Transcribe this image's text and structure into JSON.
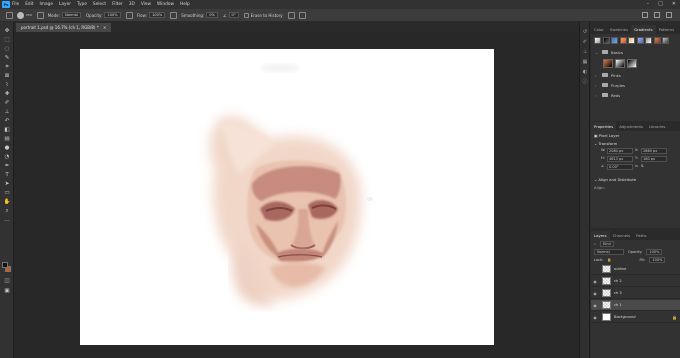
{
  "app": {
    "logo": "Ps",
    "menus": [
      "File",
      "Edit",
      "Image",
      "Layer",
      "Type",
      "Select",
      "Filter",
      "3D",
      "View",
      "Window",
      "Help"
    ],
    "window_controls": [
      "minimize-icon",
      "maximize-icon",
      "close-icon"
    ]
  },
  "options": {
    "brush_size": "250",
    "mode_label": "Mode:",
    "mode_value": "Normal",
    "opacity_label": "Opacity:",
    "opacity_value": "100%",
    "flow_label": "Flow:",
    "flow_value": "100%",
    "smoothing_label": "Smoothing:",
    "smoothing_value": "0%",
    "angle_value": "0°",
    "erase_history_label": "Erase to History"
  },
  "document": {
    "tab_label": "portrait 1.psd @ 16.7% (ch 1, RGB/8) *"
  },
  "gradients_panel": {
    "tabs": [
      "Color",
      "Swatches",
      "Gradients",
      "Patterns"
    ],
    "active_tab": "Gradients",
    "folders": [
      {
        "name": "Basics"
      },
      {
        "name": "Pinks"
      },
      {
        "name": "Purples"
      },
      {
        "name": "Reds"
      }
    ],
    "swatch_colors": [
      "#d9dbe0",
      "#3b3b3b",
      "#7da7d9",
      "#e9b27b",
      "#d7532e",
      "#f2a25c",
      "#b8a6d9",
      "#3f6ec2",
      "#8f8f8f",
      "#e37a44",
      "#7a3b2b",
      "#c9c9c9",
      "#ffffff"
    ]
  },
  "properties_panel": {
    "tabs": [
      "Properties",
      "Adjustments",
      "Libraries"
    ],
    "active_tab": "Properties",
    "layer_kind": "Pixel Layer",
    "transform_label": "Transform",
    "w_label": "W:",
    "w_value": "2084 px",
    "x_label": "X:",
    "x_value": "2860 px",
    "h_label": "H:",
    "h_value": "4613 px",
    "y_label": "Y:",
    "y_value": "180 px",
    "angle_value": "0.00°",
    "align_label": "Align and Distribute",
    "align_sub": "Align:"
  },
  "layers_panel": {
    "tabs": [
      "Layers",
      "Channels",
      "Paths"
    ],
    "active_tab": "Layers",
    "filter_label": "Kind",
    "blend_mode": "Normal",
    "opacity_label": "Opacity:",
    "opacity_value": "100%",
    "lock_label": "Lock:",
    "fill_label": "Fill:",
    "fill_value": "100%",
    "layers": [
      {
        "name": "outline",
        "visible": true,
        "selected": false
      },
      {
        "name": "ch 2",
        "visible": true,
        "selected": false
      },
      {
        "name": "ch 3",
        "visible": true,
        "selected": false
      },
      {
        "name": "ch 1",
        "visible": true,
        "selected": true
      },
      {
        "name": "Background",
        "visible": true,
        "selected": false,
        "locked": true
      }
    ]
  }
}
